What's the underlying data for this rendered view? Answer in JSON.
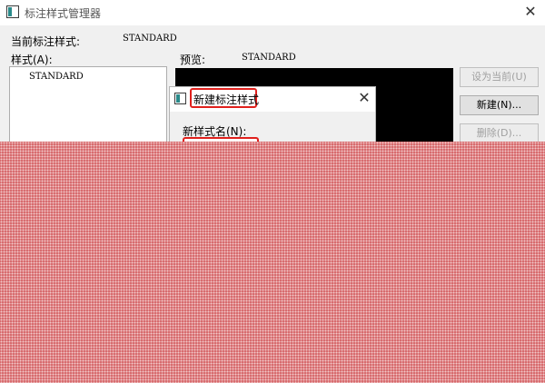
{
  "window": {
    "title": "标注样式管理器",
    "close_glyph": "✕"
  },
  "current_style": {
    "label": "当前标注样式:",
    "value": "STANDARD"
  },
  "styles": {
    "label": "样式(A):",
    "items": [
      "STANDARD"
    ]
  },
  "preview": {
    "label": "预览:",
    "value": "STANDARD"
  },
  "buttons": {
    "set_current": "设为当前(U)",
    "new": "新建(N)...",
    "delete": "删除(D)..."
  },
  "new_style_dialog": {
    "title": "新建标注样式",
    "close_glyph": "✕",
    "name_label": "新样式名(N):",
    "name_value": ""
  },
  "colors": {
    "highlight_border": "#e0201c",
    "occlusion": "#d6676a"
  },
  "icons": [
    "app-icon",
    "close-icon",
    "dialog-icon"
  ]
}
